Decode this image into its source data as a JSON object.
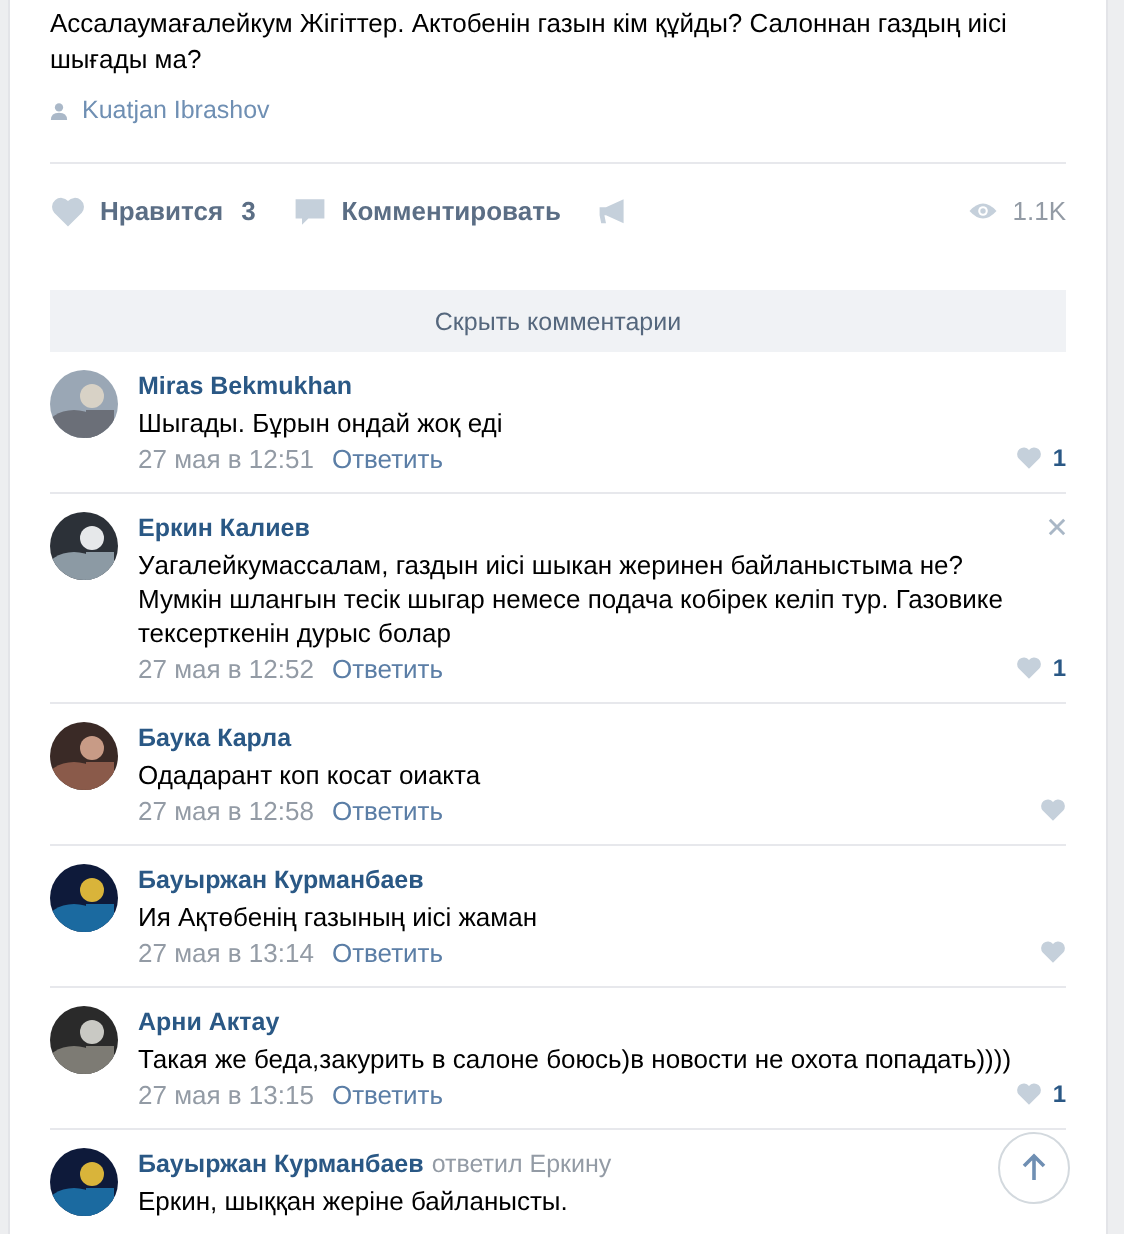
{
  "post": {
    "text": "Ассалаумағалейкум Жігіттер. Актобенін газын кім құйды? Салоннан газдың иісі шығады ма?",
    "author": "Kuatjan Ibrashov"
  },
  "actions": {
    "like_label": "Нравится",
    "like_count": "3",
    "comment_label": "Комментировать",
    "views": "1.1K"
  },
  "hide_comments_button": "Скрыть комментарии",
  "comments": [
    {
      "name": "Miras Bekmukhan",
      "text": "Шыгады. Бұрын ондай жоқ еді",
      "time": "27 мая в 12:51",
      "reply": "Ответить",
      "likes": "1",
      "close_shown": false
    },
    {
      "name": "Еркин Калиев",
      "text": "Уагалейкумассалам, газдын иісі шыкан жеринен байланыстыма не? Мумкін шлангын тесік шыгар немесе подача кобірек келіп тур. Газовике тексерткенін дурыс болар",
      "time": "27 мая в 12:52",
      "reply": "Ответить",
      "likes": "1",
      "close_shown": true
    },
    {
      "name": "Баука Карла",
      "text": "Одадарант коп косат оиакта",
      "time": "27 мая в 12:58",
      "reply": "Ответить",
      "close_shown": false
    },
    {
      "name": "Бауыржан Курманбаев",
      "text": "Ия Ақтөбенің газының иісі жаман",
      "time": "27 мая в 13:14",
      "reply": "Ответить",
      "close_shown": false
    },
    {
      "name": "Арни Актау",
      "text": "Такая же беда,закурить в салоне боюсь)в новости не охота попадать))))",
      "time": "27 мая в 13:15",
      "reply": "Ответить",
      "likes": "1",
      "close_shown": false
    },
    {
      "name": "Бауыржан Курманбаев",
      "replied_to": "ответил Еркину",
      "text": "Еркин, шыққан жеріне байланысты.",
      "close_shown": false
    }
  ]
}
